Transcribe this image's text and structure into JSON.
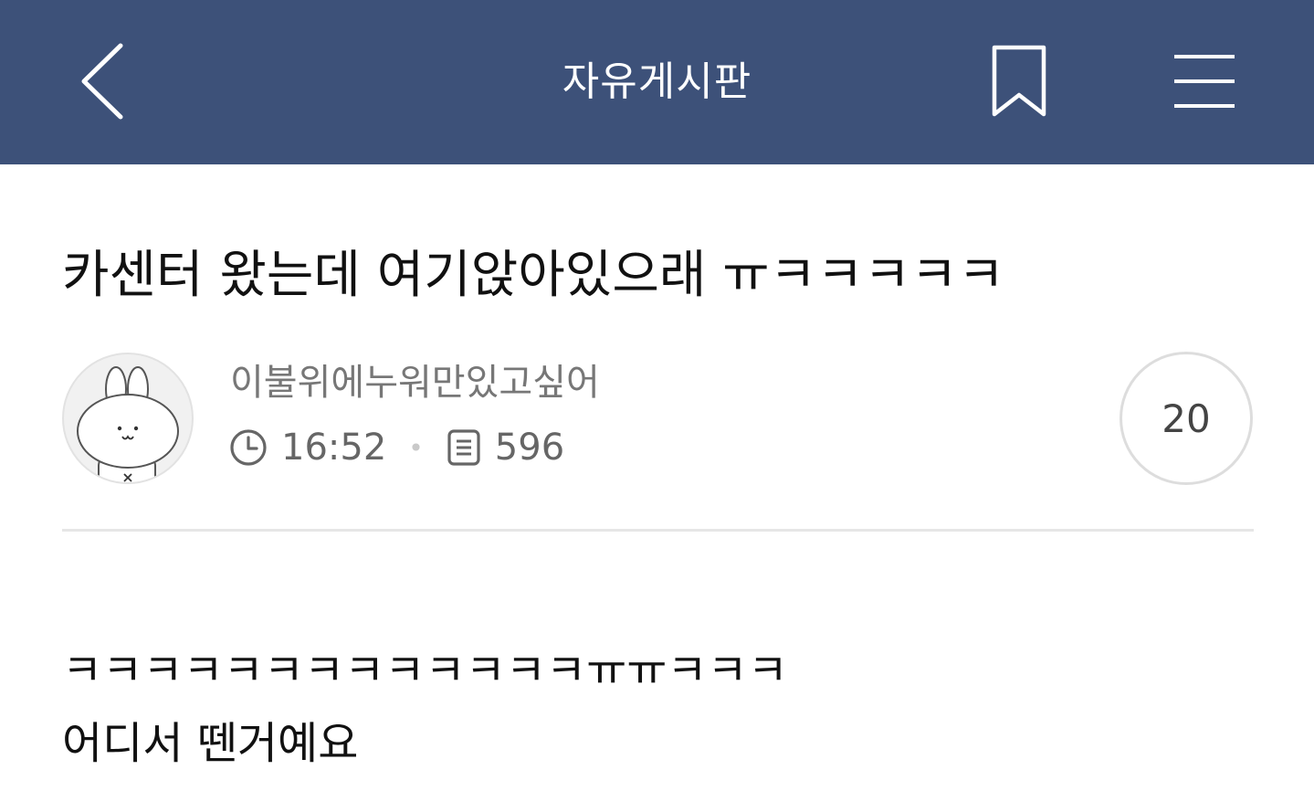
{
  "header": {
    "title": "자유게시판",
    "background_color": "#3d5179",
    "back_icon": "chevron-left-icon",
    "bookmark_icon": "bookmark-icon",
    "menu_icon": "hamburger-menu-icon"
  },
  "post": {
    "title": "카센터 왔는데 여기앉아있으래 ㅠㅋㅋㅋㅋㅋ",
    "author": "이불위에누워만있고싶어",
    "time": "16:52",
    "views": "596",
    "comment_count": "20",
    "avatar_icon": "bunny-avatar",
    "body": [
      "ㅋㅋㅋㅋㅋㅋㅋㅋㅋㅋㅋㅋㅋㅠㅠㅋㅋㅋ",
      "어디서 뗀거예요"
    ]
  }
}
